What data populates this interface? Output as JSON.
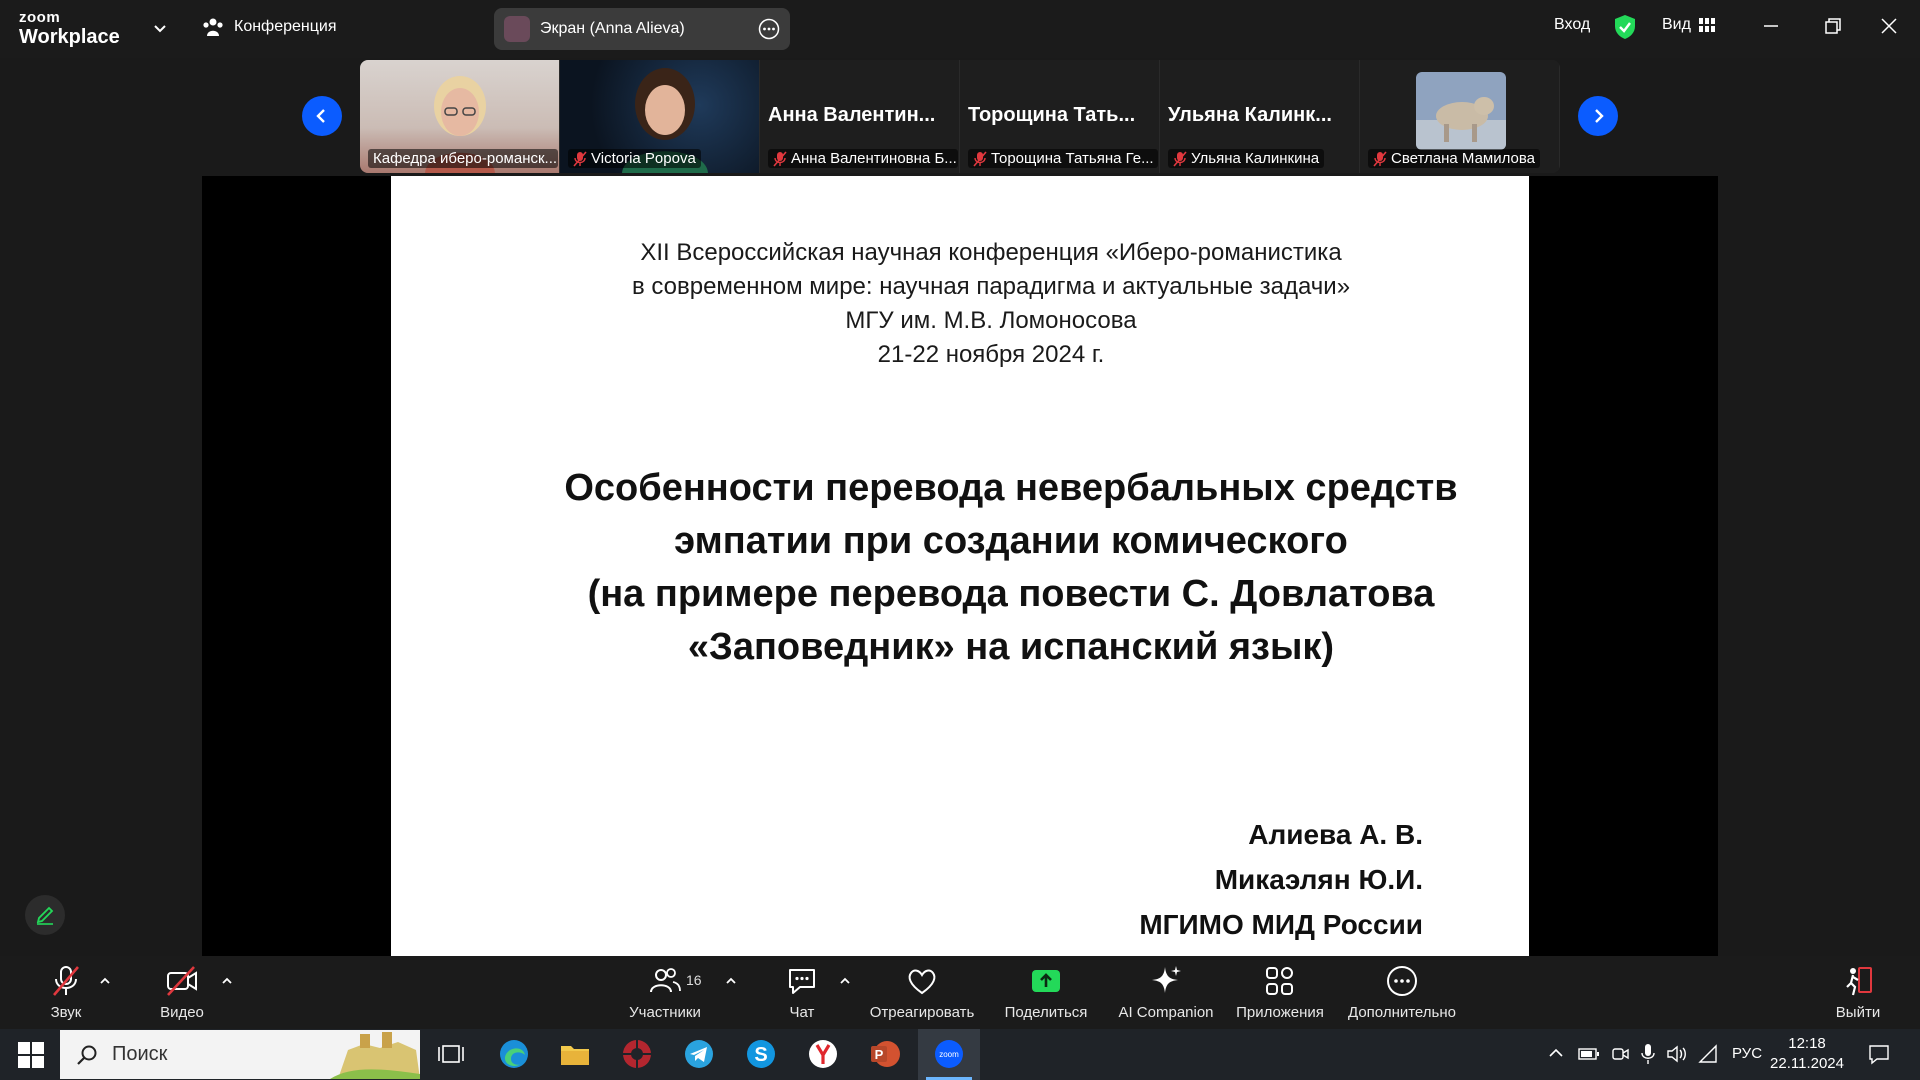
{
  "app": {
    "logo_line1": "zoom",
    "logo_line2": "Workplace",
    "meeting_label": "Конференция",
    "share_label": "Экран (Anna Alieva)",
    "signin": "Вход",
    "view": "Вид"
  },
  "participants": [
    {
      "name": "Кафедра иберо-романск...",
      "type": "video",
      "muted": false
    },
    {
      "name": "Victoria Popova",
      "type": "video",
      "muted": true
    },
    {
      "name": "Анна Валентиновна Б...",
      "big": "Анна Валентин...",
      "type": "name",
      "muted": true
    },
    {
      "name": "Торощина Татьяна Ге...",
      "big": "Торощина Тать...",
      "type": "name",
      "muted": true
    },
    {
      "name": "Ульяна Калинкина",
      "big": "Ульяна Калинк...",
      "type": "name",
      "muted": true
    },
    {
      "name": "Светлана Мамилова",
      "type": "avatar",
      "muted": true
    }
  ],
  "slide": {
    "conf_lines": [
      "XII Всероссийская научная конференция «Иберо-романистика",
      "в современном мире: научная парадигма и актуальные задачи»",
      "МГУ им. М.В. Ломоносова",
      "21-22 ноября 2024 г."
    ],
    "title_lines": [
      "Особенности перевода невербальных средств",
      "эмпатии при создании комического",
      "(на примере перевода повести С. Довлатова",
      "«Заповедник» на испанский язык)"
    ],
    "authors": [
      "Алиева А. В.",
      "Микаэлян Ю.И.",
      "МГИМО МИД России"
    ]
  },
  "toolbar": {
    "audio": "Звук",
    "video": "Видео",
    "participants": "Участники",
    "participants_count": "16",
    "chat": "Чат",
    "react": "Отреагировать",
    "share": "Поделиться",
    "ai": "AI Companion",
    "apps": "Приложения",
    "more": "Дополнительно",
    "leave": "Выйти"
  },
  "taskbar": {
    "search_placeholder": "Поиск",
    "lang": "РУС",
    "time": "12:18",
    "date": "22.11.2024"
  },
  "colors": {
    "accent_blue": "#0b5cff",
    "share_green": "#23d959",
    "mute_red": "#e0383e"
  }
}
